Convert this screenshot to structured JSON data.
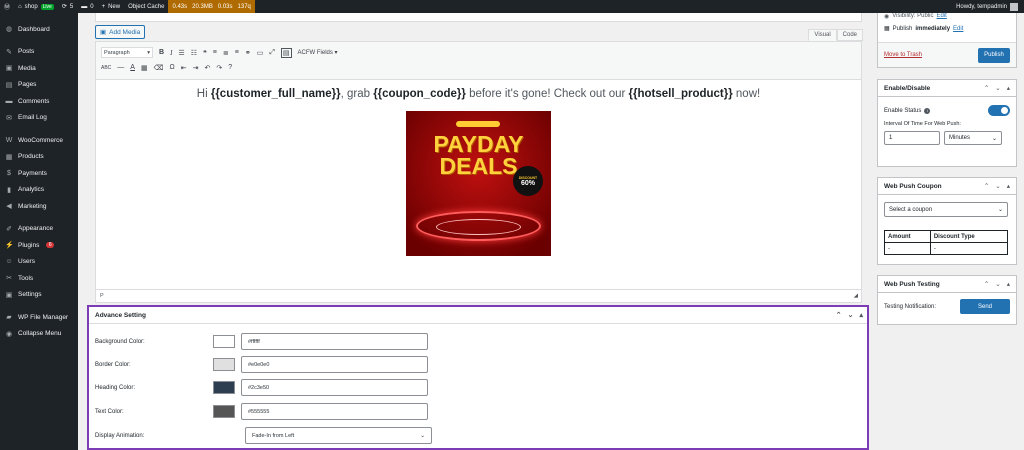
{
  "adminbar": {
    "site_name": "shop",
    "live_badge": "Live",
    "updates_count": "5",
    "comments_count": "0",
    "new_label": "New",
    "object_cache_label": "Object Cache",
    "qm_time": "0.43s",
    "qm_memory": "20.3MB",
    "qm_db_time": "0.03s",
    "qm_queries": "137q",
    "howdy": "Howdy, tempadmin"
  },
  "sidebar": {
    "items": [
      {
        "label": "Dashboard",
        "icon": "dashboard-icon",
        "glyph": "◍"
      },
      {
        "label": "Posts",
        "icon": "pin-icon",
        "glyph": "✎"
      },
      {
        "label": "Media",
        "icon": "media-icon",
        "glyph": "▣"
      },
      {
        "label": "Pages",
        "icon": "pages-icon",
        "glyph": "▤"
      },
      {
        "label": "Comments",
        "icon": "comments-icon",
        "glyph": "▬"
      },
      {
        "label": "Email Log",
        "icon": "email-icon",
        "glyph": "✉"
      },
      {
        "label": "WooCommerce",
        "icon": "woocommerce-icon",
        "glyph": "W"
      },
      {
        "label": "Products",
        "icon": "products-icon",
        "glyph": "▦"
      },
      {
        "label": "Payments",
        "icon": "payments-icon",
        "glyph": "$"
      },
      {
        "label": "Analytics",
        "icon": "analytics-icon",
        "glyph": "▮"
      },
      {
        "label": "Marketing",
        "icon": "marketing-icon",
        "glyph": "◀"
      },
      {
        "label": "Appearance",
        "icon": "appearance-icon",
        "glyph": "✐"
      },
      {
        "label": "Plugins",
        "icon": "plugins-icon",
        "glyph": "⚡",
        "badge": "6"
      },
      {
        "label": "Users",
        "icon": "users-icon",
        "glyph": "☺"
      },
      {
        "label": "Tools",
        "icon": "tools-icon",
        "glyph": "✂"
      },
      {
        "label": "Settings",
        "icon": "settings-icon",
        "glyph": "▣"
      },
      {
        "label": "WP File Manager",
        "icon": "folder-icon",
        "glyph": "▰"
      },
      {
        "label": "Collapse Menu",
        "icon": "collapse-icon",
        "glyph": "◉"
      }
    ]
  },
  "editor": {
    "add_media": "Add Media",
    "tab_visual": "Visual",
    "tab_code": "Code",
    "format_select": "Paragraph",
    "acfw_fields": "ACFW Fields",
    "greeting_pre": "Hi ",
    "customer_tag": "{{customer_full_name}}",
    "greeting_mid": ", grab ",
    "coupon_tag": "{{coupon_code}}",
    "greeting_mid2": " before it's gone! Check out our ",
    "product_tag": "{{hotsell_product}}",
    "greeting_post": " now!",
    "promo_line1": "PAYDAY",
    "promo_line2": "DEALS",
    "promo_discount_label": "DISCOUNT",
    "promo_discount": "60%",
    "path_indicator": "P"
  },
  "advance": {
    "title": "Advance Setting",
    "rows": [
      {
        "label": "Background Color:",
        "value": "#ffffff",
        "swatch": "#ffffff"
      },
      {
        "label": "Border Color:",
        "value": "#e0e0e0",
        "swatch": "#e0e0e0"
      },
      {
        "label": "Heading Color:",
        "value": "#2c3e50",
        "swatch": "#2c3e50"
      },
      {
        "label": "Text Color:",
        "value": "#555555",
        "swatch": "#555555"
      }
    ],
    "animation_label": "Display Animation:",
    "animation_value": "Fade-In from Left"
  },
  "publish": {
    "visibility": "Visibility: Public",
    "visibility_edit": "Edit",
    "publish_prefix": "Publish ",
    "publish_when": "immediately",
    "publish_edit": "Edit",
    "trash": "Move to Trash",
    "publish_button": "Publish"
  },
  "enable_panel": {
    "title": "Enable/Disable",
    "status_label": "Enable Status",
    "status_on": true,
    "interval_label": "Interval Of Time For Web Push:",
    "interval_value": "1",
    "interval_unit": "Minutes"
  },
  "coupon_panel": {
    "title": "Web Push Coupon",
    "select_placeholder": "Select a coupon",
    "col_amount": "Amount",
    "col_type": "Discount Type",
    "cell_amount": "-",
    "cell_type": "-"
  },
  "testing_panel": {
    "title": "Web Push Testing",
    "label": "Testing Notification:",
    "send": "Send"
  },
  "colors": {
    "primary": "#2271b1",
    "highlight_border": "#7b3cb5",
    "admin_dark": "#1d2327"
  }
}
